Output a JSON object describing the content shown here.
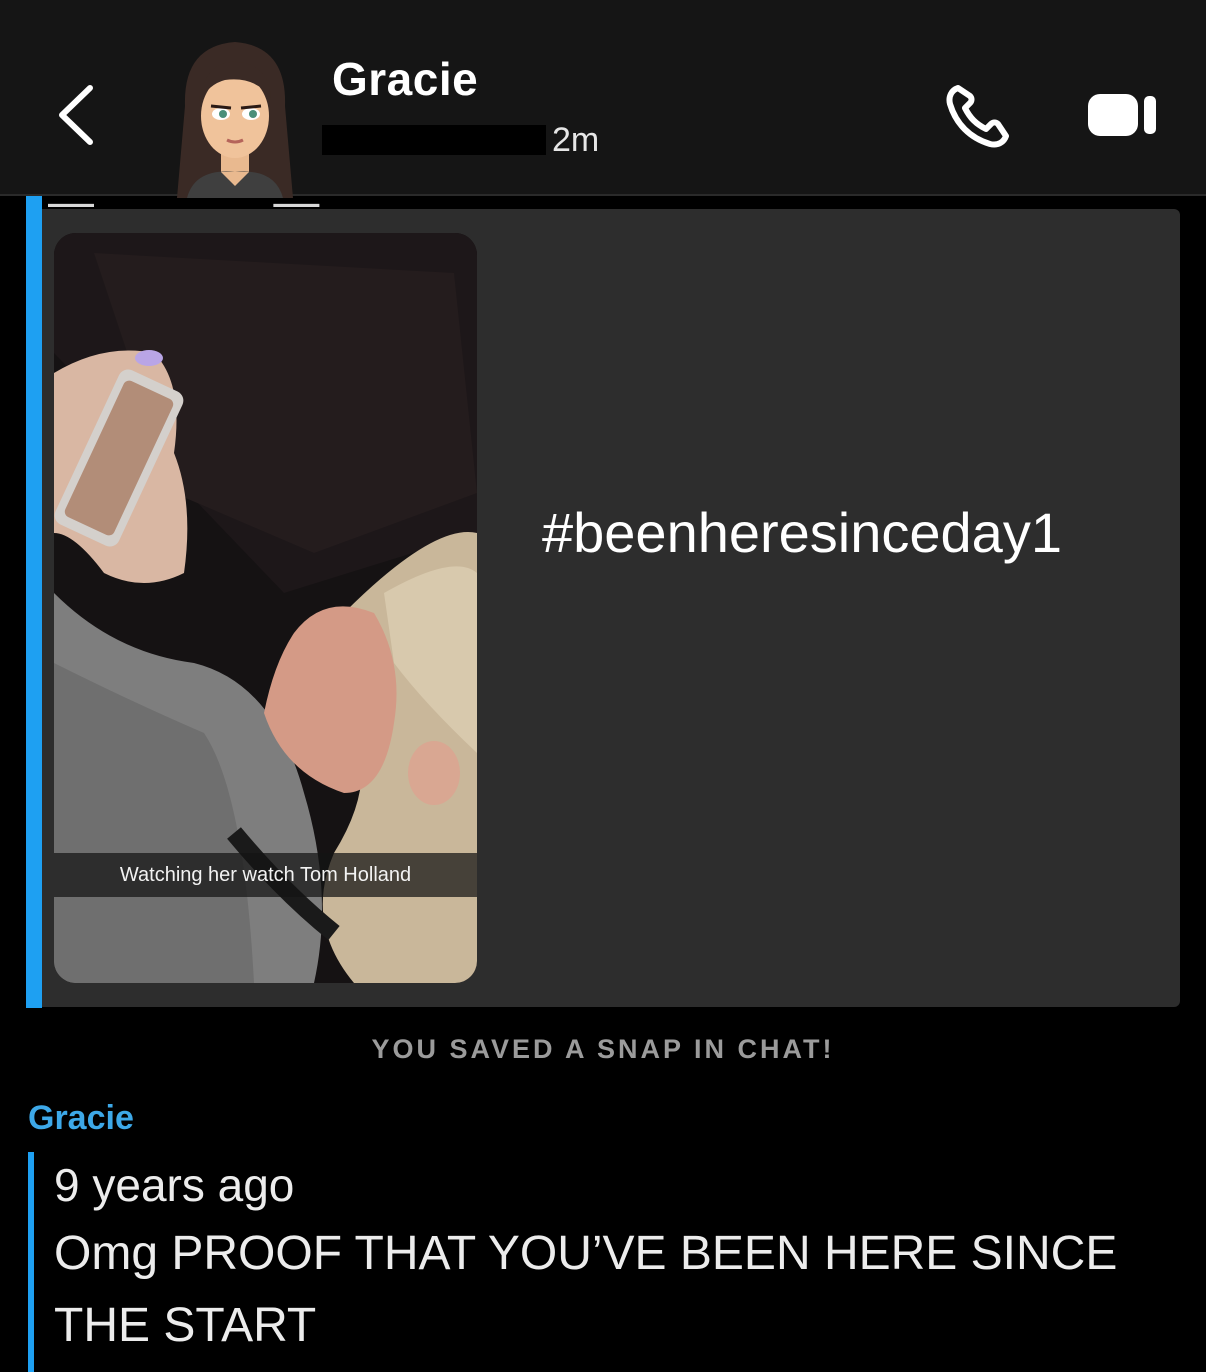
{
  "header": {
    "contact_name": "Gracie",
    "time_ago": "2m"
  },
  "snap": {
    "caption": "Watching her watch Tom Holland",
    "hashtag": "#beenheresinceday1"
  },
  "system_message": "YOU SAVED A SNAP IN CHAT!",
  "message": {
    "sender": "Gracie",
    "timestamp": "9 years ago",
    "text": "Omg PROOF THAT YOU’VE BEEN HERE SINCE THE START"
  },
  "colors": {
    "accent_blue": "#1ea0f2",
    "sender_blue": "#3da8e8",
    "card_bg": "#2d2d2d",
    "header_bg": "#151515"
  },
  "icons": {
    "back": "chevron-left-icon",
    "call": "phone-icon",
    "video": "video-camera-icon"
  }
}
